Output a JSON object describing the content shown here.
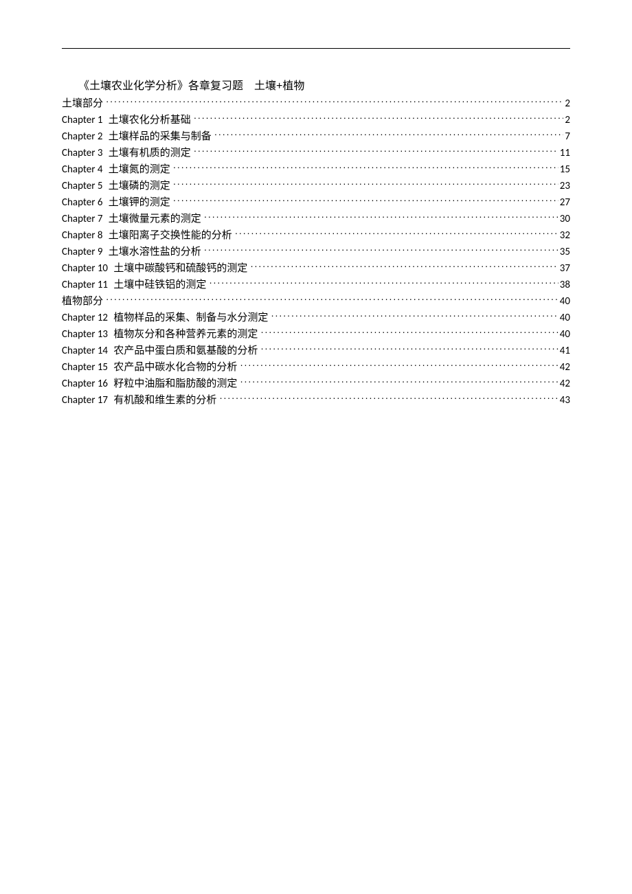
{
  "title": "《土壤农业化学分析》各章复习题　土壤+植物",
  "toc": [
    {
      "label": "",
      "text": "土壤部分",
      "page": "2"
    },
    {
      "label": "Chapter 1",
      "text": "土壤农化分析基础",
      "page": "2"
    },
    {
      "label": "Chapter 2",
      "text": "土壤样品的采集与制备",
      "page": "7"
    },
    {
      "label": "Chapter 3",
      "text": "土壤有机质的测定",
      "page": "11"
    },
    {
      "label": "Chapter 4",
      "text": "土壤氮的测定",
      "page": "15"
    },
    {
      "label": "Chapter 5",
      "text": "土壤磷的测定",
      "page": "23"
    },
    {
      "label": "Chapter 6",
      "text": "土壤钾的测定",
      "page": "27"
    },
    {
      "label": "Chapter 7",
      "text": "土壤微量元素的测定",
      "page": "30"
    },
    {
      "label": "Chapter 8",
      "text": "土壤阳离子交换性能的分析",
      "page": "32"
    },
    {
      "label": "Chapter 9",
      "text": "土壤水溶性盐的分析",
      "page": "35"
    },
    {
      "label": "Chapter 10",
      "text": "土壤中碳酸钙和硫酸钙的测定",
      "page": "37"
    },
    {
      "label": "Chapter 11",
      "text": "土壤中硅铁铝的测定",
      "page": "38"
    },
    {
      "label": "",
      "text": "植物部分",
      "page": "40"
    },
    {
      "label": "Chapter 12",
      "text": "植物样品的采集、制备与水分测定",
      "page": "40"
    },
    {
      "label": "Chapter 13",
      "text": "植物灰分和各种营养元素的测定",
      "page": "40"
    },
    {
      "label": "Chapter 14",
      "text": "农产品中蛋白质和氨基酸的分析",
      "page": "41"
    },
    {
      "label": "Chapter 15",
      "text": "农产品中碳水化合物的分析",
      "page": "42"
    },
    {
      "label": "Chapter 16",
      "text": "籽粒中油脂和脂肪酸的测定",
      "page": "42"
    },
    {
      "label": "Chapter 17",
      "text": "有机酸和维生素的分析",
      "page": "43"
    }
  ]
}
